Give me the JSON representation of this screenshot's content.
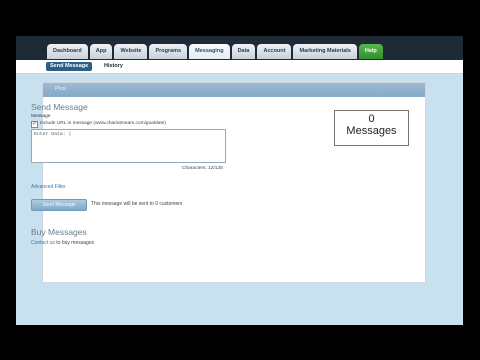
{
  "nav": {
    "tabs": [
      {
        "label": "Dashboard"
      },
      {
        "label": "App"
      },
      {
        "label": "Website"
      },
      {
        "label": "Programs"
      },
      {
        "label": "Messaging"
      },
      {
        "label": "Data"
      },
      {
        "label": "Account"
      },
      {
        "label": "Marketing Materials"
      },
      {
        "label": "Help"
      }
    ],
    "active_tab": "Messaging"
  },
  "subnav": {
    "send_message": "Send Message",
    "history": "History"
  },
  "panel": {
    "header": "Plus"
  },
  "compose": {
    "heading": "Send Message",
    "message_label": "Message",
    "include_url_label": "Include URL in message (www.chariotmears.com/goaldate)",
    "include_url_checked": true,
    "message_value": "Enter Data: |",
    "characters": "Characters: 12/125",
    "advanced_filter": "Advanced Filter",
    "send_button": "Send Message",
    "recipients_text": "This message will be sent to 0 customers"
  },
  "buy": {
    "heading": "Buy Messages",
    "contact_link": "Contact us",
    "suffix": " to buy messages"
  },
  "counter": {
    "value": "0",
    "label": "Messages"
  },
  "colors": {
    "accent": "#2c5f87",
    "help_tab": "#3f9f38",
    "panel_header": "#8fb0ca",
    "background": "#c9e0ee"
  }
}
